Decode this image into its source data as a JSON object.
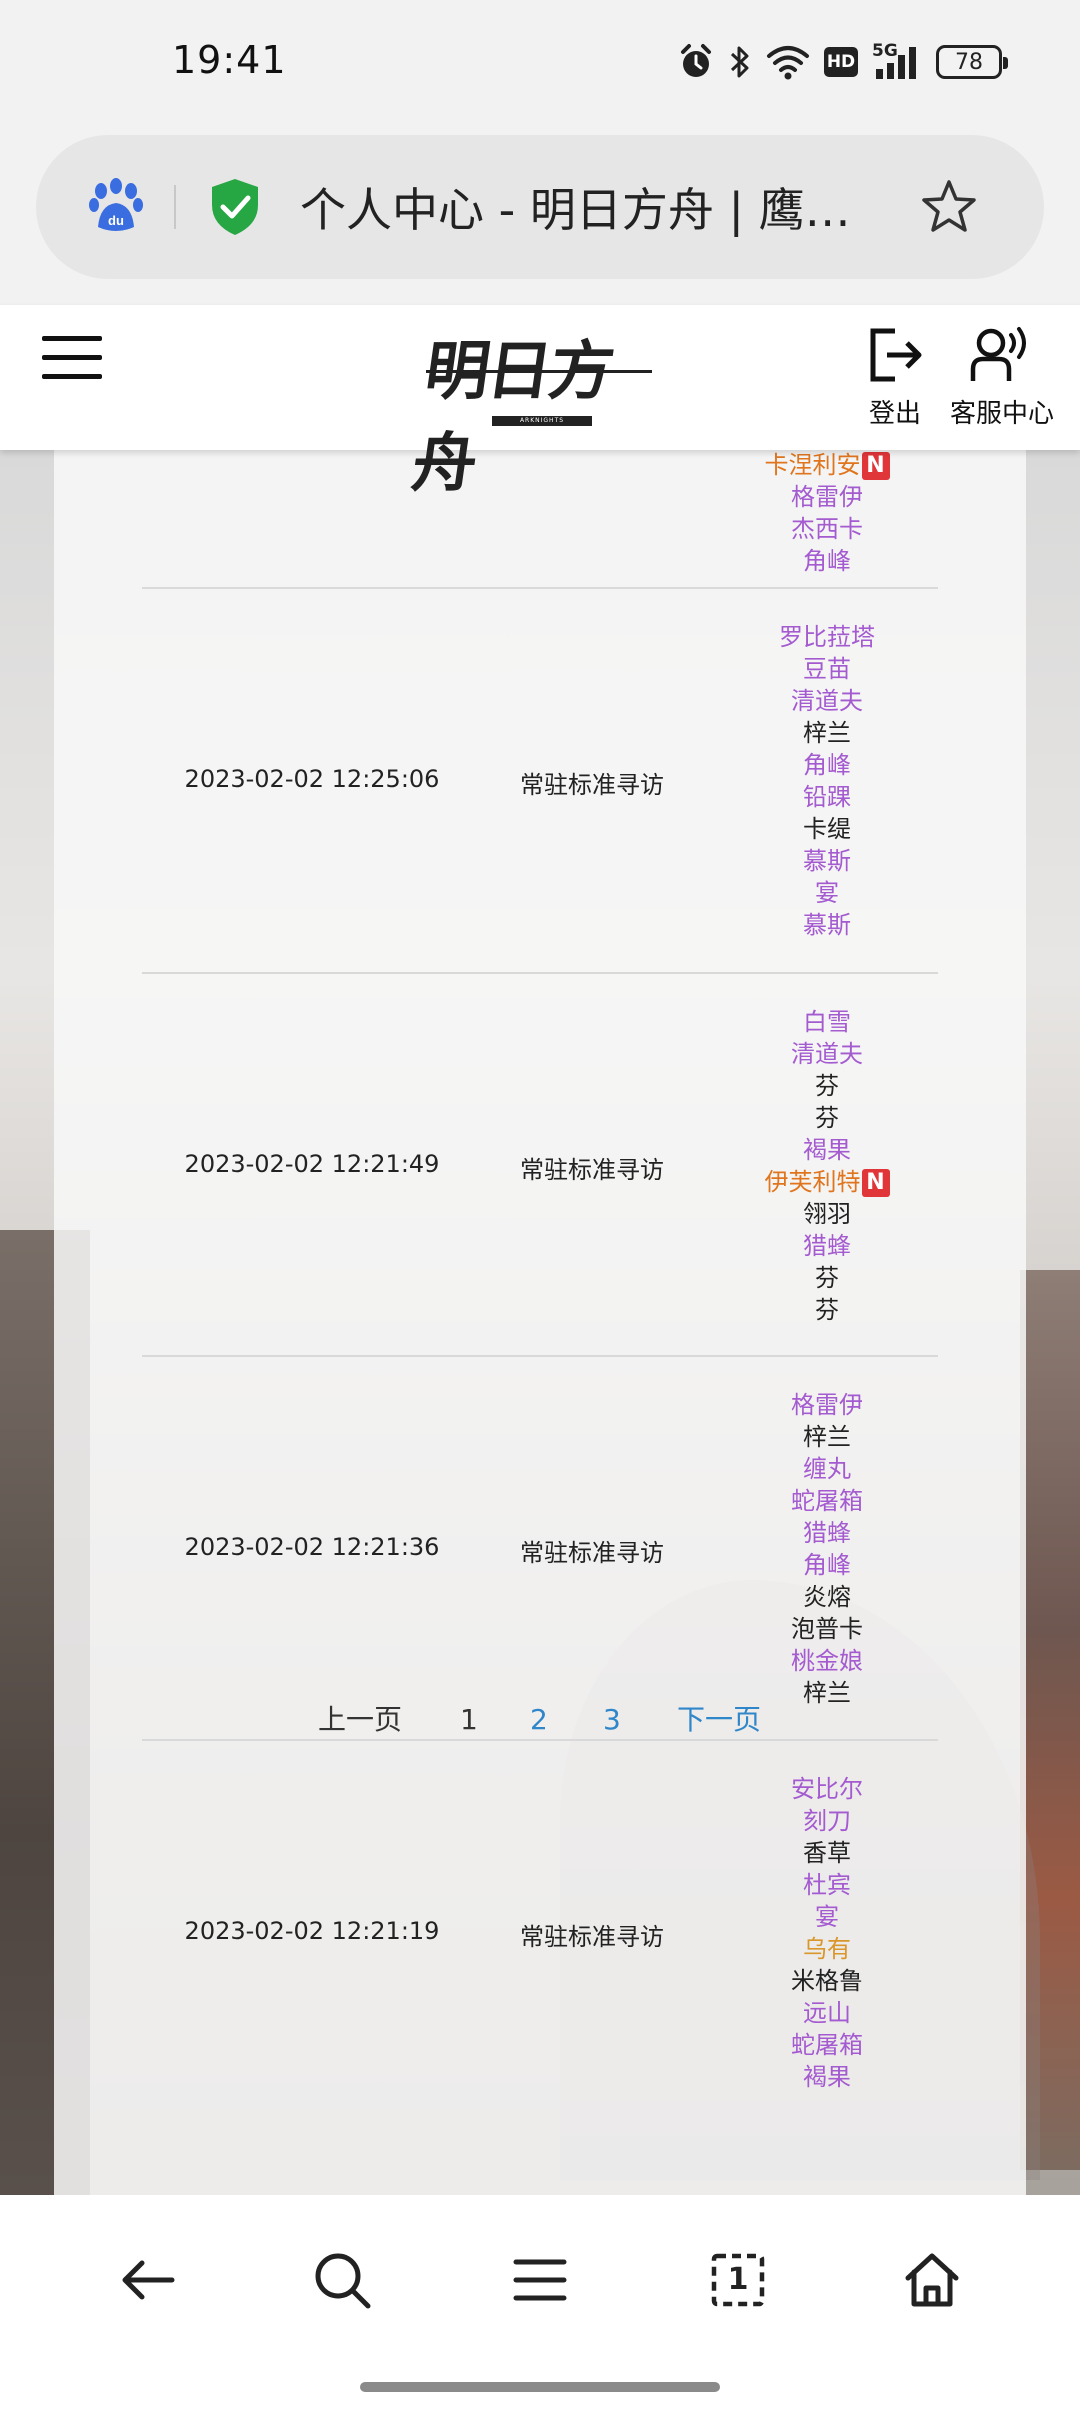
{
  "status_bar": {
    "time": "19:41",
    "battery": "78",
    "network_label": "5G",
    "hd_label": "HD"
  },
  "browser": {
    "page_title": "个人中心 - 明日方舟 | 鹰角...",
    "address_icon": "baidu-paw-icon",
    "security_icon": "shield-check-icon",
    "bookmark_icon": "star-icon"
  },
  "site_header": {
    "logo_text": "明日方舟",
    "logo_subtext": "ARKNIGHTS",
    "logout_label": "登出",
    "service_label": "客服中心"
  },
  "colors": {
    "op_black": "#222222",
    "op_purple": "#a45bd0",
    "op_gold": "#d9962a",
    "op_orange": "#e0751e",
    "link_blue": "#2f86c9",
    "new_badge": "#e0363a"
  },
  "records": [
    {
      "time": "",
      "type": "",
      "operators": [
        {
          "name": "卡涅利安",
          "color": "op_orange",
          "new": true
        },
        {
          "name": "格雷伊",
          "color": "op_purple",
          "new": false
        },
        {
          "name": "杰西卡",
          "color": "op_purple",
          "new": false
        },
        {
          "name": "角峰",
          "color": "op_purple",
          "new": false
        }
      ]
    },
    {
      "time": "2023-02-02 12:25:06",
      "type": "常驻标准寻访",
      "operators": [
        {
          "name": "罗比菈塔",
          "color": "op_purple",
          "new": false
        },
        {
          "name": "豆苗",
          "color": "op_purple",
          "new": false
        },
        {
          "name": "清道夫",
          "color": "op_purple",
          "new": false
        },
        {
          "name": "梓兰",
          "color": "op_black",
          "new": false
        },
        {
          "name": "角峰",
          "color": "op_purple",
          "new": false
        },
        {
          "name": "铅踝",
          "color": "op_purple",
          "new": false
        },
        {
          "name": "卡缇",
          "color": "op_black",
          "new": false
        },
        {
          "name": "慕斯",
          "color": "op_purple",
          "new": false
        },
        {
          "name": "宴",
          "color": "op_purple",
          "new": false
        },
        {
          "name": "慕斯",
          "color": "op_purple",
          "new": false
        }
      ]
    },
    {
      "time": "2023-02-02 12:21:49",
      "type": "常驻标准寻访",
      "operators": [
        {
          "name": "白雪",
          "color": "op_purple",
          "new": false
        },
        {
          "name": "清道夫",
          "color": "op_purple",
          "new": false
        },
        {
          "name": "芬",
          "color": "op_black",
          "new": false
        },
        {
          "name": "芬",
          "color": "op_black",
          "new": false
        },
        {
          "name": "褐果",
          "color": "op_purple",
          "new": false
        },
        {
          "name": "伊芙利特",
          "color": "op_orange",
          "new": true
        },
        {
          "name": "翎羽",
          "color": "op_black",
          "new": false
        },
        {
          "name": "猎蜂",
          "color": "op_purple",
          "new": false
        },
        {
          "name": "芬",
          "color": "op_black",
          "new": false
        },
        {
          "name": "芬",
          "color": "op_black",
          "new": false
        }
      ]
    },
    {
      "time": "2023-02-02 12:21:36",
      "type": "常驻标准寻访",
      "operators": [
        {
          "name": "格雷伊",
          "color": "op_purple",
          "new": false
        },
        {
          "name": "梓兰",
          "color": "op_black",
          "new": false
        },
        {
          "name": "缠丸",
          "color": "op_purple",
          "new": false
        },
        {
          "name": "蛇屠箱",
          "color": "op_purple",
          "new": false
        },
        {
          "name": "猎蜂",
          "color": "op_purple",
          "new": false
        },
        {
          "name": "角峰",
          "color": "op_purple",
          "new": false
        },
        {
          "name": "炎熔",
          "color": "op_black",
          "new": false
        },
        {
          "name": "泡普卡",
          "color": "op_black",
          "new": false
        },
        {
          "name": "桃金娘",
          "color": "op_purple",
          "new": false
        },
        {
          "name": "梓兰",
          "color": "op_black",
          "new": false
        }
      ]
    },
    {
      "time": "2023-02-02 12:21:19",
      "type": "常驻标准寻访",
      "operators": [
        {
          "name": "安比尔",
          "color": "op_purple",
          "new": false
        },
        {
          "name": "刻刀",
          "color": "op_purple",
          "new": false
        },
        {
          "name": "香草",
          "color": "op_black",
          "new": false
        },
        {
          "name": "杜宾",
          "color": "op_purple",
          "new": false
        },
        {
          "name": "宴",
          "color": "op_purple",
          "new": false
        },
        {
          "name": "乌有",
          "color": "op_gold",
          "new": false
        },
        {
          "name": "米格鲁",
          "color": "op_black",
          "new": false
        },
        {
          "name": "远山",
          "color": "op_purple",
          "new": false
        },
        {
          "name": "蛇屠箱",
          "color": "op_purple",
          "new": false
        },
        {
          "name": "褐果",
          "color": "op_purple",
          "new": false
        }
      ]
    }
  ],
  "pagination": {
    "prev_label": "上一页",
    "pages": [
      "1",
      "2",
      "3"
    ],
    "current": "1",
    "next_label": "下一页"
  },
  "bottom_nav": {
    "back_icon": "back-arrow-icon",
    "search_icon": "search-icon",
    "menu_icon": "menu-icon",
    "tabs_icon": "tabs-icon",
    "tabs_count": "1",
    "home_icon": "home-icon"
  }
}
